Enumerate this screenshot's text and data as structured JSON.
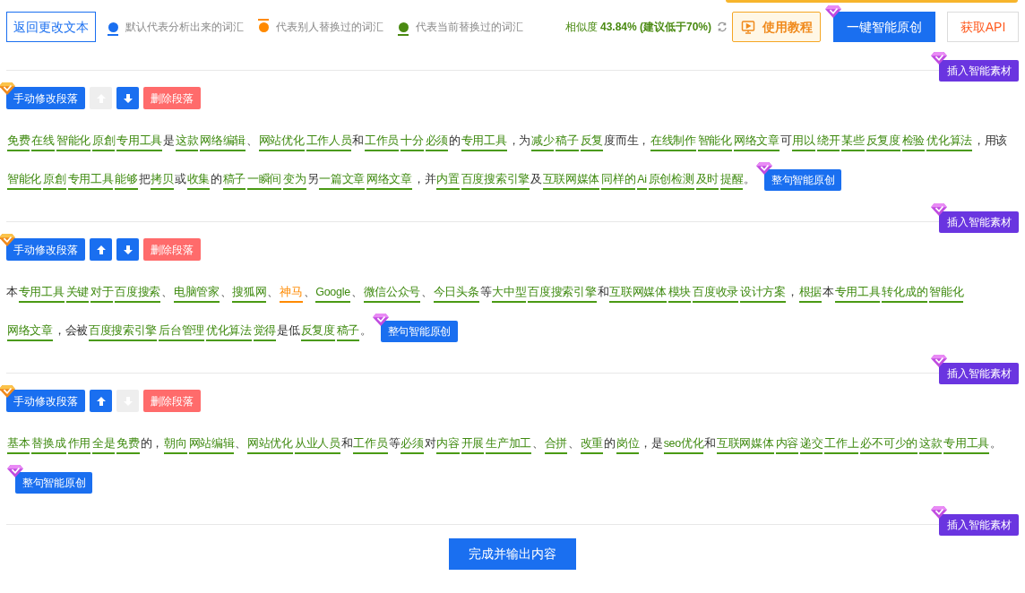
{
  "toolbar": {
    "back_button": "返回更改文本",
    "legend": [
      {
        "label": "默认代表分析出来的词汇",
        "kind": "default",
        "color": "#1a6ff0"
      },
      {
        "label": "代表别人替换过的词汇",
        "kind": "others",
        "color": "#ff8a00"
      },
      {
        "label": "代表当前替换过的词汇",
        "kind": "current",
        "color": "#4a8a12"
      }
    ],
    "similarity": {
      "label": "相似度",
      "value": "43.84% (建议低于70%)"
    },
    "tutorial_button": "使用教程",
    "rewrite_all_button": "一键智能原创",
    "api_button": "获取API"
  },
  "paragraphs": [
    {
      "insert_button": "插入智能素材",
      "edit_button": "手动修改段落",
      "move_up_disabled": true,
      "move_down_disabled": false,
      "delete_button": "删除段落",
      "rewrite_button": "整句智能原创",
      "segments": [
        {
          "text": "免费",
          "kind": "current"
        },
        {
          "text": "在线",
          "kind": "current"
        },
        {
          "text": "智能化",
          "kind": "current"
        },
        {
          "text": "原創",
          "kind": "current"
        },
        {
          "text": "专用工具",
          "kind": "current"
        },
        {
          "text": "是",
          "kind": "plain"
        },
        {
          "text": "这款",
          "kind": "current"
        },
        {
          "text": "网络编辑",
          "kind": "current"
        },
        {
          "text": "、",
          "kind": "plain"
        },
        {
          "text": "网站优化",
          "kind": "current"
        },
        {
          "text": "工作人员",
          "kind": "current"
        },
        {
          "text": "和",
          "kind": "plain"
        },
        {
          "text": "工作员",
          "kind": "current"
        },
        {
          "text": "十分",
          "kind": "current"
        },
        {
          "text": "必须",
          "kind": "current"
        },
        {
          "text": "的",
          "kind": "plain"
        },
        {
          "text": "专用工具",
          "kind": "current"
        },
        {
          "text": "，为",
          "kind": "plain"
        },
        {
          "text": "减少",
          "kind": "current"
        },
        {
          "text": "稿子",
          "kind": "current"
        },
        {
          "text": "反复",
          "kind": "current"
        },
        {
          "text": "度而生，",
          "kind": "plain"
        },
        {
          "text": "在线制作",
          "kind": "current"
        },
        {
          "text": "智能化",
          "kind": "current"
        },
        {
          "text": "网络文章",
          "kind": "current"
        },
        {
          "text": "可",
          "kind": "plain"
        },
        {
          "text": "用以",
          "kind": "current"
        },
        {
          "text": "绕开",
          "kind": "current"
        },
        {
          "text": "某些",
          "kind": "current"
        },
        {
          "text": "反复度",
          "kind": "current"
        },
        {
          "text": "检验",
          "kind": "current"
        },
        {
          "text": "优化算法",
          "kind": "current"
        },
        {
          "text": "，用该",
          "kind": "plain"
        },
        {
          "text": "智能化",
          "kind": "current"
        },
        {
          "text": "原創",
          "kind": "current"
        },
        {
          "text": "专用工具",
          "kind": "current"
        },
        {
          "text": "能够",
          "kind": "current"
        },
        {
          "text": "把",
          "kind": "plain"
        },
        {
          "text": "拷贝",
          "kind": "current"
        },
        {
          "text": "或",
          "kind": "plain"
        },
        {
          "text": "收集",
          "kind": "current"
        },
        {
          "text": "的",
          "kind": "plain"
        },
        {
          "text": "稿子",
          "kind": "current"
        },
        {
          "text": "一瞬间",
          "kind": "current"
        },
        {
          "text": "变为",
          "kind": "current"
        },
        {
          "text": "另",
          "kind": "plain"
        },
        {
          "text": "一篇文章",
          "kind": "current"
        },
        {
          "text": "网络文章",
          "kind": "current"
        },
        {
          "text": "，并",
          "kind": "plain"
        },
        {
          "text": "内置",
          "kind": "current"
        },
        {
          "text": "百度搜索引擎",
          "kind": "current"
        },
        {
          "text": "及",
          "kind": "plain"
        },
        {
          "text": "互联网媒体",
          "kind": "current"
        },
        {
          "text": "同样的",
          "kind": "current"
        },
        {
          "text": "Ai",
          "kind": "current"
        },
        {
          "text": "原创检测",
          "kind": "current"
        },
        {
          "text": "及时",
          "kind": "current"
        },
        {
          "text": "提醒",
          "kind": "current"
        },
        {
          "text": "。",
          "kind": "plain"
        }
      ]
    },
    {
      "insert_button": "插入智能素材",
      "edit_button": "手动修改段落",
      "move_up_disabled": false,
      "move_down_disabled": false,
      "delete_button": "删除段落",
      "rewrite_button": "整句智能原创",
      "segments": [
        {
          "text": "本",
          "kind": "plain"
        },
        {
          "text": "专用工具",
          "kind": "current"
        },
        {
          "text": "关键",
          "kind": "current"
        },
        {
          "text": "对于",
          "kind": "current"
        },
        {
          "text": "百度搜索",
          "kind": "current"
        },
        {
          "text": "、",
          "kind": "plain"
        },
        {
          "text": "电脑管家",
          "kind": "current"
        },
        {
          "text": "、",
          "kind": "plain"
        },
        {
          "text": "搜狐网",
          "kind": "current"
        },
        {
          "text": "、",
          "kind": "plain"
        },
        {
          "text": "神马",
          "kind": "others"
        },
        {
          "text": "、",
          "kind": "plain"
        },
        {
          "text": "Google",
          "kind": "current"
        },
        {
          "text": "、",
          "kind": "plain"
        },
        {
          "text": "微信公众号",
          "kind": "current"
        },
        {
          "text": "、",
          "kind": "plain"
        },
        {
          "text": "今日头条",
          "kind": "current"
        },
        {
          "text": "等",
          "kind": "plain"
        },
        {
          "text": "大中型",
          "kind": "current"
        },
        {
          "text": "百度搜索引擎",
          "kind": "current"
        },
        {
          "text": "和",
          "kind": "plain"
        },
        {
          "text": "互联网媒体",
          "kind": "current"
        },
        {
          "text": "模块",
          "kind": "current"
        },
        {
          "text": "百度收录",
          "kind": "current"
        },
        {
          "text": "设计方案",
          "kind": "current"
        },
        {
          "text": "，",
          "kind": "plain"
        },
        {
          "text": "根据",
          "kind": "current"
        },
        {
          "text": "本",
          "kind": "plain"
        },
        {
          "text": "专用工具",
          "kind": "current"
        },
        {
          "text": "转化成的",
          "kind": "current"
        },
        {
          "text": "智能化",
          "kind": "current"
        },
        {
          "text": "网络文章",
          "kind": "current"
        },
        {
          "text": "，会被",
          "kind": "plain"
        },
        {
          "text": "百度搜索引擎",
          "kind": "current"
        },
        {
          "text": "后台管理",
          "kind": "current"
        },
        {
          "text": "优化算法",
          "kind": "current"
        },
        {
          "text": "觉得",
          "kind": "current"
        },
        {
          "text": "是低",
          "kind": "plain"
        },
        {
          "text": "反复度",
          "kind": "current"
        },
        {
          "text": "稿子",
          "kind": "current"
        },
        {
          "text": "。",
          "kind": "plain"
        }
      ]
    },
    {
      "insert_button": "插入智能素材",
      "edit_button": "手动修改段落",
      "move_up_disabled": false,
      "move_down_disabled": true,
      "delete_button": "删除段落",
      "rewrite_button": "整句智能原创",
      "segments": [
        {
          "text": "基本",
          "kind": "current"
        },
        {
          "text": "替换成",
          "kind": "current"
        },
        {
          "text": "作用",
          "kind": "current"
        },
        {
          "text": "全是",
          "kind": "current"
        },
        {
          "text": "免费",
          "kind": "current"
        },
        {
          "text": "的，",
          "kind": "plain"
        },
        {
          "text": "朝向",
          "kind": "current"
        },
        {
          "text": "网站编辑",
          "kind": "current"
        },
        {
          "text": "、",
          "kind": "plain"
        },
        {
          "text": "网站优化",
          "kind": "current"
        },
        {
          "text": "从业人员",
          "kind": "current"
        },
        {
          "text": "和",
          "kind": "plain"
        },
        {
          "text": "工作员",
          "kind": "current"
        },
        {
          "text": "等",
          "kind": "plain"
        },
        {
          "text": "必须",
          "kind": "current"
        },
        {
          "text": "对",
          "kind": "plain"
        },
        {
          "text": "内容",
          "kind": "current"
        },
        {
          "text": "开展",
          "kind": "current"
        },
        {
          "text": "生产加工",
          "kind": "current"
        },
        {
          "text": "、",
          "kind": "plain"
        },
        {
          "text": "合拼",
          "kind": "current"
        },
        {
          "text": "、",
          "kind": "plain"
        },
        {
          "text": "改重",
          "kind": "current"
        },
        {
          "text": "的",
          "kind": "plain"
        },
        {
          "text": "岗位",
          "kind": "current"
        },
        {
          "text": "，是",
          "kind": "plain"
        },
        {
          "text": "seo优化",
          "kind": "current"
        },
        {
          "text": "和",
          "kind": "plain"
        },
        {
          "text": "互联网媒体",
          "kind": "current"
        },
        {
          "text": "内容",
          "kind": "current"
        },
        {
          "text": "递交",
          "kind": "current"
        },
        {
          "text": "工作上",
          "kind": "current"
        },
        {
          "text": "必不可少的",
          "kind": "current"
        },
        {
          "text": "这款",
          "kind": "current"
        },
        {
          "text": "专用工具",
          "kind": "current"
        },
        {
          "text": "。",
          "kind": "plain"
        }
      ]
    }
  ],
  "footer": {
    "insert_button": "插入智能素材",
    "finish_button": "完成并输出内容"
  }
}
